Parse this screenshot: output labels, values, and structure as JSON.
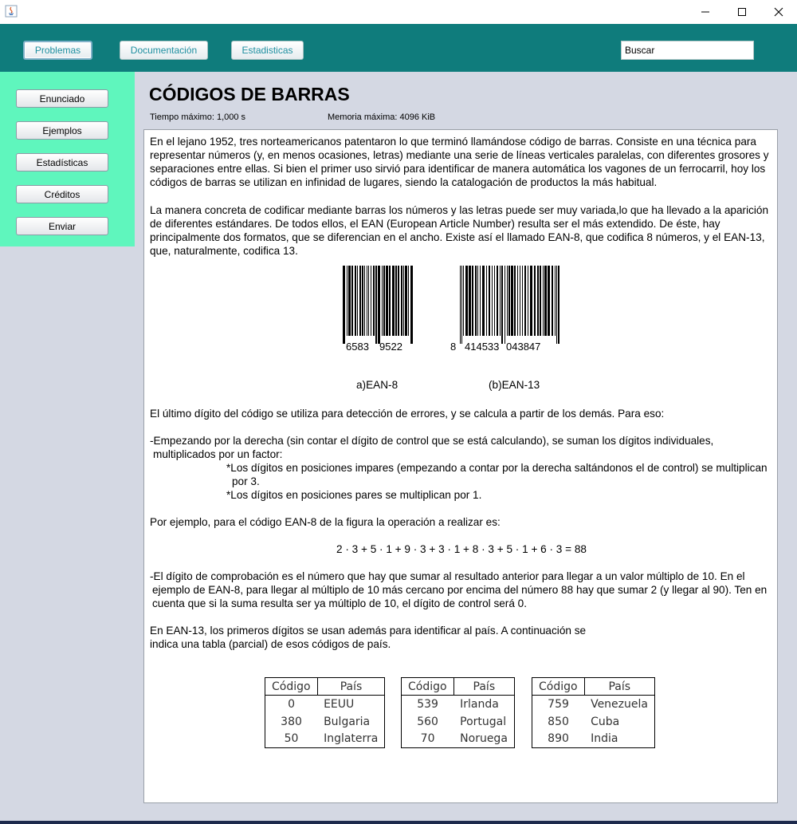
{
  "window": {
    "minimize": "—",
    "maximize": "☐",
    "close": "✕"
  },
  "nav": {
    "problems": "Problemas",
    "docs": "Documentación",
    "stats": "Estadisticas",
    "search_value": "Buscar"
  },
  "sidebar": {
    "items": [
      "Enunciado",
      "Ejemplos",
      "Estadísticas",
      "Créditos",
      "Enviar"
    ]
  },
  "problem": {
    "title": "CÓDIGOS DE BARRAS",
    "time_limit": "Tiempo máximo: 1,000 s",
    "memory_limit": "Memoria máxima: 4096 KiB",
    "p1": "En el lejano 1952, tres norteamericanos patentaron lo que terminó llamándose código de barras. Consiste en una técnica para representar números (y, en menos ocasiones, letras) mediante una serie de líneas verticales paralelas, con diferentes grosores y separaciones entre ellas. Si bien el primer uso sirvió para identificar de manera automática los vagones de un ferrocarril, hoy los códigos de barras se utilizan en infinidad de lugares, siendo la catalogación de productos la más habitual.",
    "p2": "La manera concreta de codificar mediante barras los números y las letras puede ser muy variada,lo que ha llevado a la aparición de diferentes estándares. De todos ellos, el EAN (European Article Number) resulta ser el más extendido. De éste, hay principalmente dos formatos, que se diferencian en el ancho. Existe así el llamado EAN-8, que codifica 8 números, y el EAN-13, que, naturalmente, codifica 13.",
    "barcode1_digits_left": "6583",
    "barcode1_digits_right": "9522",
    "barcode2_digit_first": "8",
    "barcode2_digits_left": "414533",
    "barcode2_digits_right": "043847",
    "caption1": "a)EAN-8",
    "caption2": "(b)EAN-13",
    "p3": "El último dígito del código se utiliza para detección de errores, y se calcula a partir de los demás. Para eso:",
    "p4a": "-Empezando por la derecha (sin contar el dígito de control que se está calculando), se suman los dígitos individuales,",
    "p4b": "multiplicados por un factor:",
    "p4c": "*Los dígitos en posiciones impares (empezando a contar por la derecha saltándonos el de control) se multiplican",
    "p4d": "por 3.",
    "p4e": "*Los dígitos en posiciones pares se multiplican por 1.",
    "p5": "Por ejemplo, para el código EAN-8 de la figura la operación a realizar es:",
    "formula": "2 · 3 + 5 · 1 + 9 · 3 + 3 · 1 + 8 · 3 + 5 · 1 + 6 · 3 = 88",
    "p6a": "-El dígito de comprobación es el número que hay que sumar al resultado anterior para llegar a un  valor múltiplo de 10. En el",
    "p6b": "ejemplo de EAN-8, para llegar al múltiplo de 10 más cercano por encima del número 88 hay que sumar 2 (y llegar al 90). Ten en",
    "p6c": "cuenta que si la suma resulta ser ya múltiplo de 10, el dígito de control será 0.",
    "p7a": "En EAN-13, los primeros dígitos se usan además para identificar al país. A continuación se",
    "p7b": "indica una tabla (parcial) de esos códigos de país."
  },
  "tables": [
    {
      "h_code": "Código",
      "h_country": "País",
      "rows": [
        {
          "code": "0",
          "country": "EEUU"
        },
        {
          "code": "380",
          "country": "Bulgaria"
        },
        {
          "code": "50",
          "country": "Inglaterra"
        }
      ]
    },
    {
      "h_code": "Código",
      "h_country": "País",
      "rows": [
        {
          "code": "539",
          "country": "Irlanda"
        },
        {
          "code": "560",
          "country": "Portugal"
        },
        {
          "code": "70",
          "country": "Noruega"
        }
      ]
    },
    {
      "h_code": "Código",
      "h_country": "País",
      "rows": [
        {
          "code": "759",
          "country": "Venezuela"
        },
        {
          "code": "850",
          "country": "Cuba"
        },
        {
          "code": "890",
          "country": "India"
        }
      ]
    }
  ]
}
